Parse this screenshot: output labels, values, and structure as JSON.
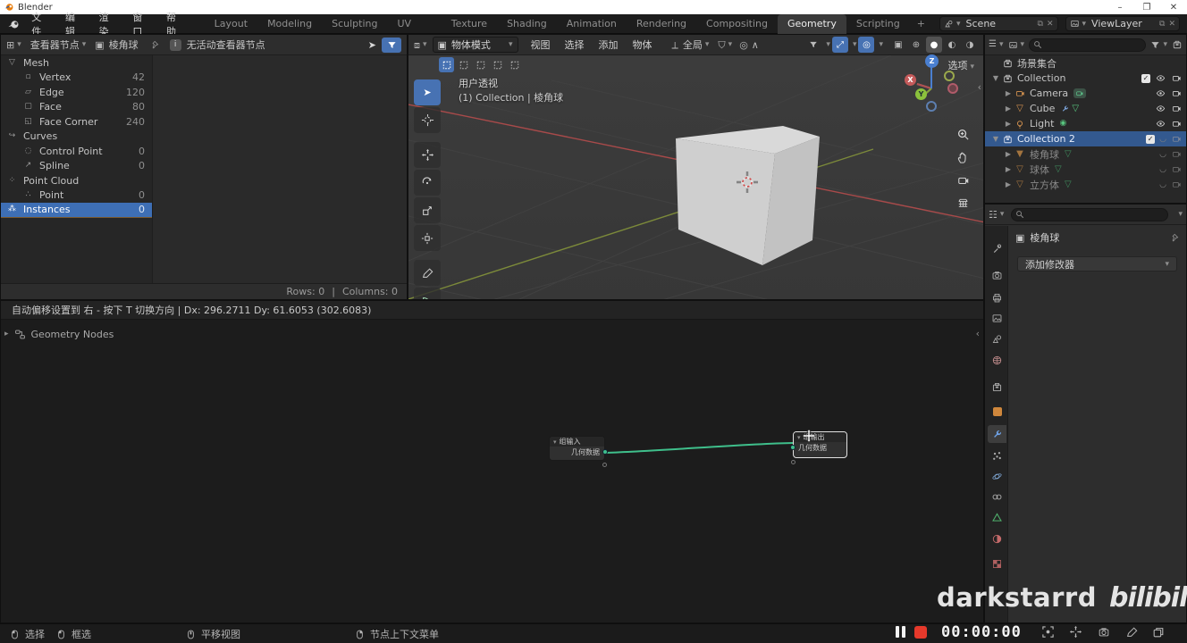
{
  "window": {
    "title": "Blender"
  },
  "menubar": {
    "menus": [
      "文件",
      "编辑",
      "渲染",
      "窗口",
      "帮助"
    ],
    "tabs": [
      "Layout",
      "Modeling",
      "Sculpting",
      "UV Editing",
      "Texture Paint",
      "Shading",
      "Animation",
      "Rendering",
      "Compositing",
      "Geometry Nodes",
      "Scripting"
    ],
    "active_tab": "Geometry Nodes",
    "add_tab": "+",
    "scene": "Scene",
    "view_layer": "ViewLayer"
  },
  "spreadsheet": {
    "viewer_dropdown": "查看器节点",
    "object_name": "棱角球",
    "warning": "无活动查看器节点",
    "rows": [
      {
        "label": "Mesh",
        "value": ""
      },
      {
        "label": "Vertex",
        "value": "42"
      },
      {
        "label": "Edge",
        "value": "120"
      },
      {
        "label": "Face",
        "value": "80"
      },
      {
        "label": "Face Corner",
        "value": "240"
      },
      {
        "label": "Curves",
        "value": ""
      },
      {
        "label": "Control Point",
        "value": "0"
      },
      {
        "label": "Spline",
        "value": "0"
      },
      {
        "label": "Point Cloud",
        "value": ""
      },
      {
        "label": "Point",
        "value": "0"
      },
      {
        "label": "Instances",
        "value": "0"
      }
    ],
    "footer": {
      "rows": "Rows: 0",
      "sep": "|",
      "columns": "Columns: 0"
    }
  },
  "viewport": {
    "mode": "物体模式",
    "menus": [
      "视图",
      "选择",
      "添加",
      "物体"
    ],
    "orientation": "全局",
    "options": "选项",
    "overlay_title": "用户透视",
    "overlay_subtitle": "(1) Collection | 棱角球",
    "axes": {
      "x": "X",
      "y": "Y",
      "z": "Z"
    }
  },
  "outliner": {
    "root": "场景集合",
    "items": [
      {
        "label": "Collection"
      },
      {
        "label": "Camera"
      },
      {
        "label": "Cube"
      },
      {
        "label": "Light"
      },
      {
        "label": "Collection 2"
      },
      {
        "label": "棱角球"
      },
      {
        "label": "球体"
      },
      {
        "label": "立方体"
      }
    ]
  },
  "properties": {
    "object_name": "棱角球",
    "add_modifier": "添加修改器"
  },
  "node_editor": {
    "status": "自动偏移设置到 右 - 按下 T 切换方向  |  Dx: 296.2711   Dy: 61.6053 (302.6083)",
    "breadcrumb": "Geometry Nodes",
    "group_input": {
      "title": "组输入",
      "socket": "几何数据"
    },
    "group_output": {
      "title": "组输出",
      "socket": "几何数据"
    }
  },
  "statusbar": {
    "hints": [
      {
        "label": "选择"
      },
      {
        "label": "框选"
      },
      {
        "label": "平移视图"
      },
      {
        "label": "节点上下文菜单"
      }
    ]
  },
  "recorder": {
    "time": "00:00:00"
  },
  "watermark": {
    "name": "darkstarrd",
    "logo": "bilibili"
  },
  "colors": {
    "accent": "#4772b3",
    "wire": "#3fbf8b",
    "record": "#e6392b",
    "axis_x": "#a84a4a",
    "axis_y": "#7c8a3a"
  }
}
